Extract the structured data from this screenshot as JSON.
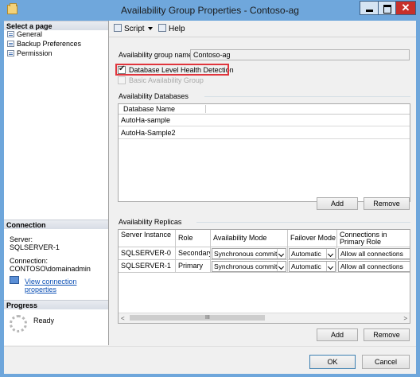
{
  "window": {
    "title": "Availability Group Properties - Contoso-ag"
  },
  "left_pane": {
    "select_page_heading": "Select a page",
    "pages": [
      {
        "label": "General"
      },
      {
        "label": "Backup Preferences"
      },
      {
        "label": "Permission"
      }
    ],
    "connection_heading": "Connection",
    "server_label": "Server:",
    "server_value": "SQLSERVER-1",
    "connection_label": "Connection:",
    "connection_value": "CONTOSO\\domainadmin",
    "view_connection_link": "View connection properties",
    "progress_heading": "Progress",
    "progress_status": "Ready"
  },
  "toolbar": {
    "script_label": "Script",
    "help_label": "Help"
  },
  "general": {
    "ag_name_label": "Availability group name:",
    "ag_name_value": "Contoso-ag",
    "db_health_label": "Database Level Health Detection",
    "db_health_checked": true,
    "basic_ag_label": "Basic Availability Group",
    "basic_ag_checked": false
  },
  "availability_databases": {
    "section_label": "Availability Databases",
    "column_header": "Database Name",
    "rows": [
      "AutoHa-sample",
      "AutoHa-Sample2"
    ],
    "add_button": "Add",
    "remove_button": "Remove"
  },
  "availability_replicas": {
    "section_label": "Availability Replicas",
    "columns": [
      "Server Instance",
      "Role",
      "Availability Mode",
      "Failover Mode",
      "Connections in Primary Role"
    ],
    "rows": [
      {
        "server": "SQLSERVER-0",
        "role": "Secondary",
        "mode": "Synchronous commit",
        "failover": "Automatic",
        "connections": "Allow all connections"
      },
      {
        "server": "SQLSERVER-1",
        "role": "Primary",
        "mode": "Synchronous commit",
        "failover": "Automatic",
        "connections": "Allow all connections"
      }
    ],
    "scroll_grip": "III",
    "add_button": "Add",
    "remove_button": "Remove"
  },
  "dialog_buttons": {
    "ok": "OK",
    "cancel": "Cancel"
  },
  "colors": {
    "title_bar": "#6fa7dc",
    "close_button": "#c7302a",
    "highlight_box": "#e0353d",
    "link": "#0b4fb4"
  }
}
